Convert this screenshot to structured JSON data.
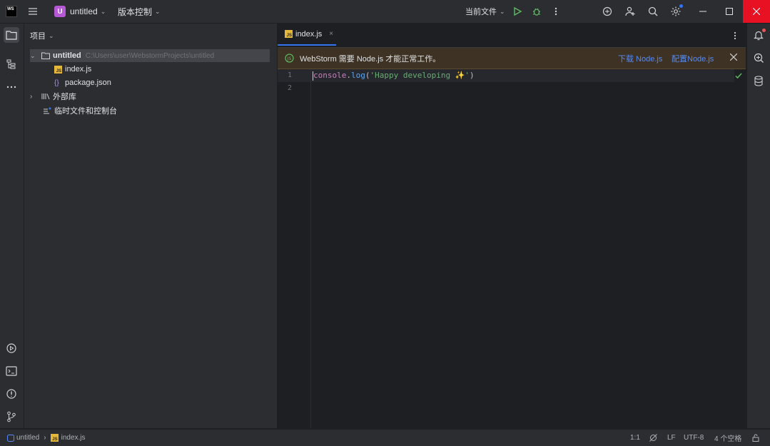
{
  "titlebar": {
    "logo_text": "WS",
    "project_initial": "U",
    "project_name": "untitled",
    "vcs_label": "版本控制",
    "run_config": "当前文件"
  },
  "project_panel": {
    "title": "项目",
    "root_name": "untitled",
    "root_path": "C:\\Users\\user\\WebstormProjects\\untitled",
    "files": [
      {
        "name": "index.js",
        "type": "js"
      },
      {
        "name": "package.json",
        "type": "json"
      }
    ],
    "external_libraries": "外部库",
    "scratches": "临时文件和控制台"
  },
  "editor": {
    "tab_label": "index.js",
    "banner_text": "WebStorm 需要 Node.js 才能正常工作。",
    "banner_link_download": "下载 Node.js",
    "banner_link_configure": "配置Node.js",
    "line_numbers": [
      "1",
      "2"
    ],
    "code": {
      "obj": "console",
      "dot": ".",
      "method": "log",
      "open": "(",
      "string": "'Happy developing ✨'",
      "close": ")"
    }
  },
  "statusbar": {
    "crumb_project": "untitled",
    "crumb_file": "index.js",
    "position": "1:1",
    "line_ending": "LF",
    "encoding": "UTF-8",
    "indent": "4 个空格"
  },
  "colors": {
    "accent": "#3574f0",
    "close_red": "#e81123",
    "project_badge": "#b657d6",
    "js_badge": "#e5b73b",
    "banner_bg": "#3d3223",
    "string_green": "#6aab73",
    "method_blue": "#56a8f5"
  },
  "icons": [
    "hamburger-icon",
    "run-icon",
    "debug-icon",
    "more-icon",
    "code-with-me-icon",
    "add-user-icon",
    "search-icon",
    "settings-icon",
    "minimize-icon",
    "maximize-icon",
    "close-icon",
    "folder-icon",
    "structure-icon",
    "notifications-icon",
    "ai-icon",
    "database-icon",
    "services-icon",
    "terminal-icon",
    "problems-icon",
    "git-icon"
  ]
}
